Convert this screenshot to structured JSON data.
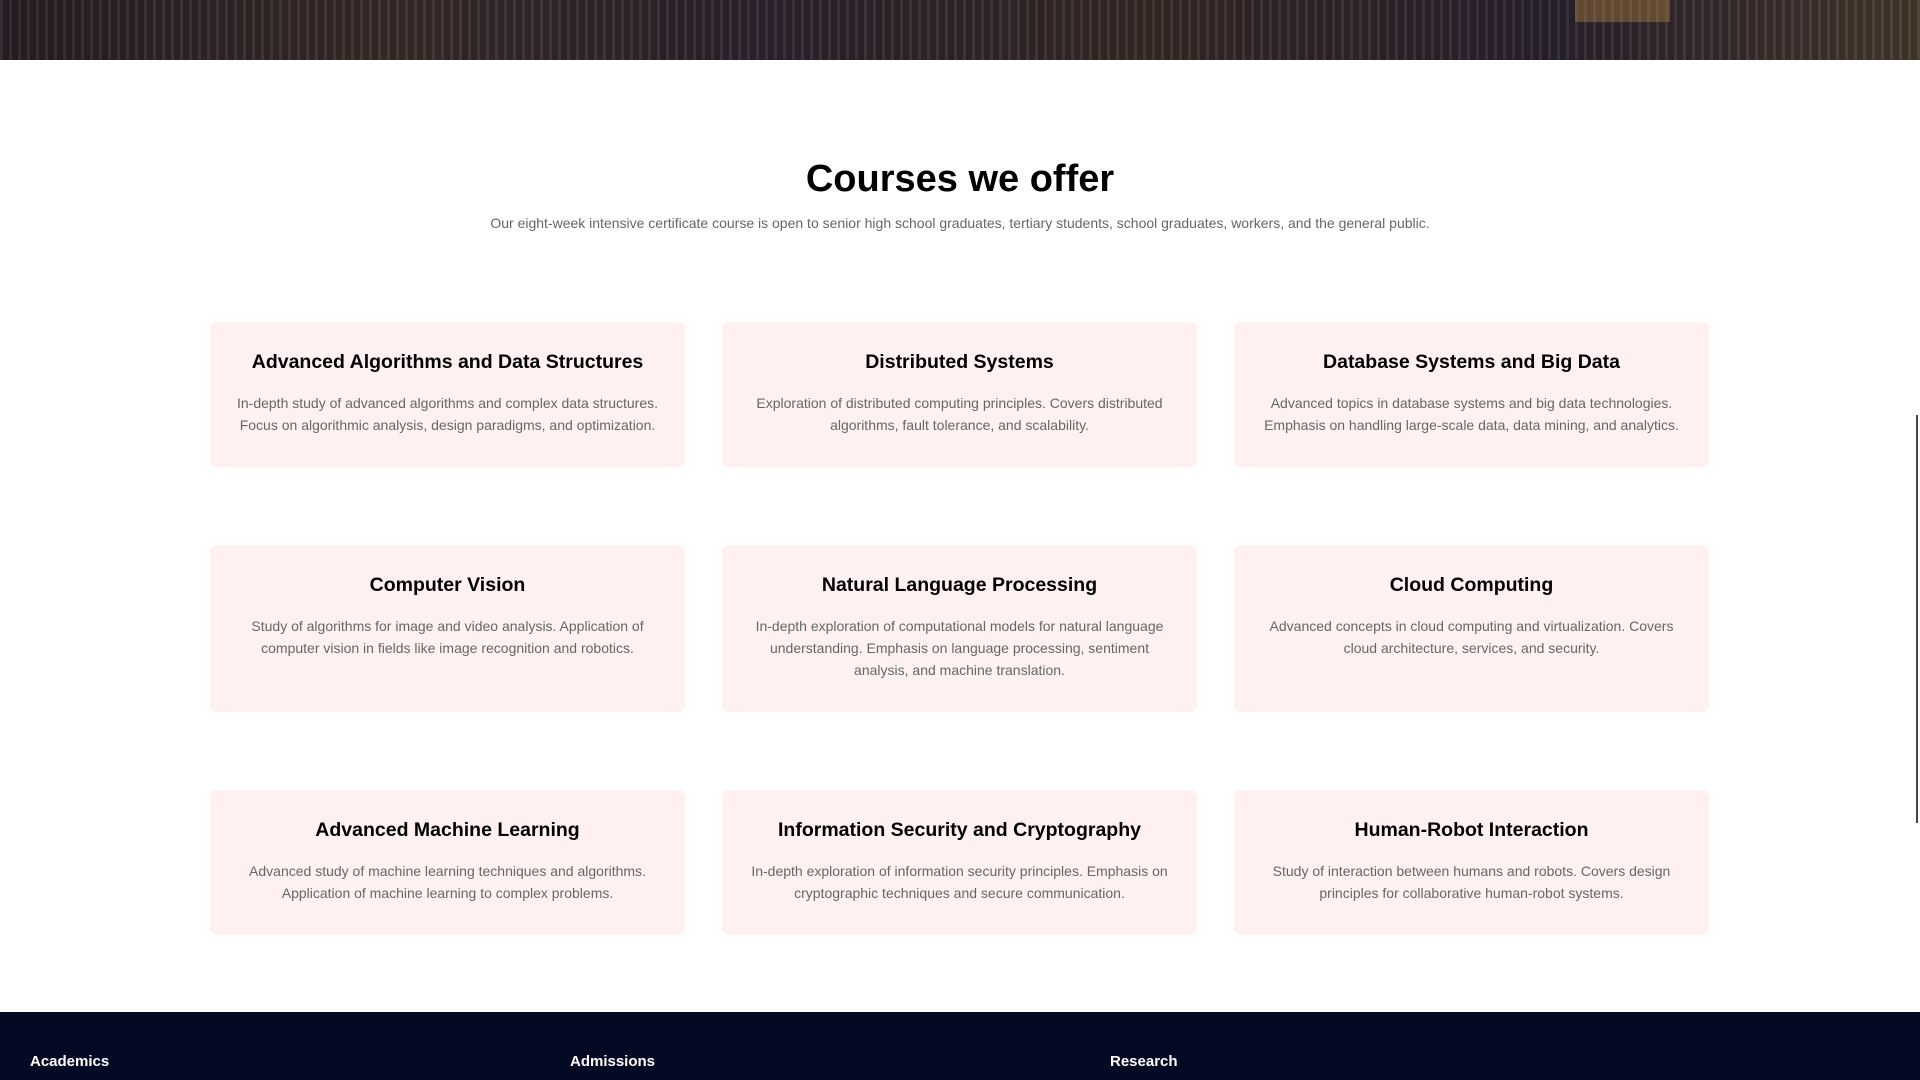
{
  "section": {
    "title": "Courses we offer",
    "subtitle": "Our eight-week intensive certificate course is open to senior high school graduates, tertiary students, school graduates, workers, and the general public."
  },
  "courses": [
    {
      "title": "Advanced Algorithms and Data Structures",
      "description": "In-depth study of advanced algorithms and complex data structures. Focus on algorithmic analysis, design paradigms, and optimization."
    },
    {
      "title": "Distributed Systems",
      "description": "Exploration of distributed computing principles. Covers distributed algorithms, fault tolerance, and scalability."
    },
    {
      "title": "Database Systems and Big Data",
      "description": "Advanced topics in database systems and big data technologies. Emphasis on handling large-scale data, data mining, and analytics."
    },
    {
      "title": "Computer Vision",
      "description": "Study of algorithms for image and video analysis. Application of computer vision in fields like image recognition and robotics."
    },
    {
      "title": "Natural Language Processing",
      "description": "In-depth exploration of computational models for natural language understanding. Emphasis on language processing, sentiment analysis, and machine translation."
    },
    {
      "title": "Cloud Computing",
      "description": "Advanced concepts in cloud computing and virtualization. Covers cloud architecture, services, and security."
    },
    {
      "title": "Advanced Machine Learning",
      "description": "Advanced study of machine learning techniques and algorithms. Application of machine learning to complex problems."
    },
    {
      "title": "Information Security and Cryptography",
      "description": "In-depth exploration of information security principles. Emphasis on cryptographic techniques and secure communication."
    },
    {
      "title": "Human-Robot Interaction",
      "description": "Study of interaction between humans and robots. Covers design principles for collaborative human-robot systems."
    }
  ],
  "footer": {
    "columns": [
      "Academics",
      "Admissions",
      "Research"
    ]
  },
  "colors": {
    "card_background": "#fff1f1",
    "footer_background": "#050a24",
    "muted_text": "#666666"
  }
}
